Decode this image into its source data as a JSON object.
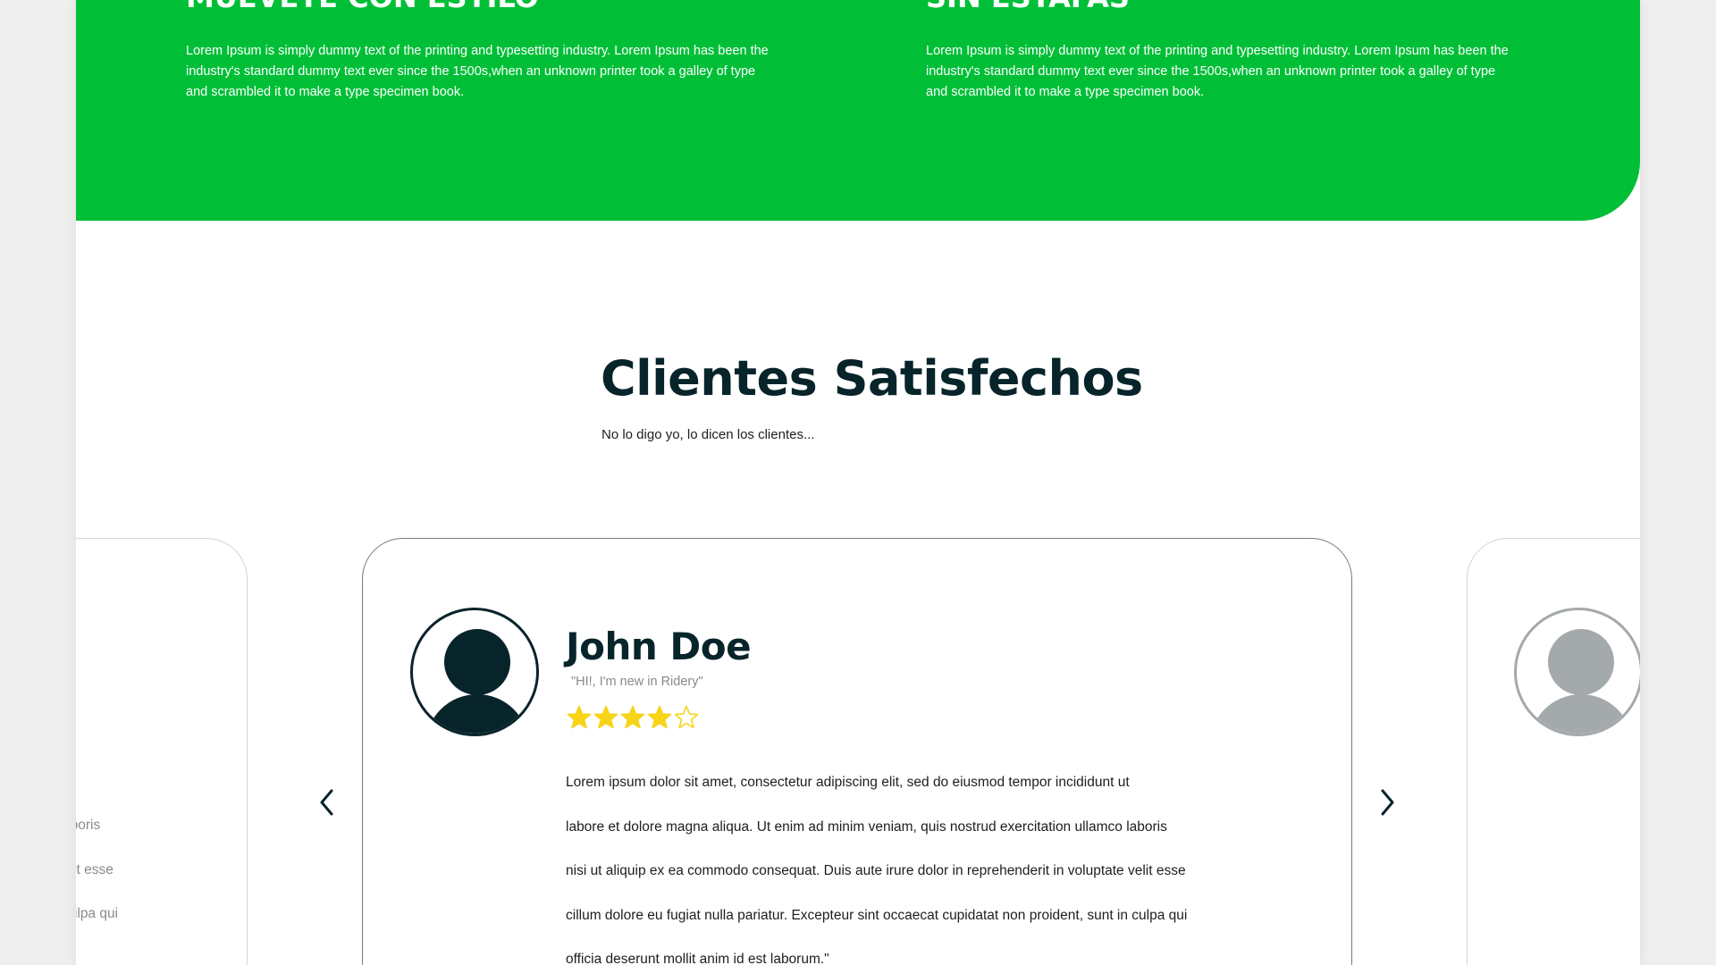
{
  "colors": {
    "brand_green": "#00bf37",
    "heading_dark": "#08242b",
    "body_text": "#1e1e1e",
    "muted_text": "#8a8a8a",
    "star_gold": "#f7d417",
    "avatar_faded": "#a4a9ac",
    "page_bg": "#efefef"
  },
  "hero": {
    "features": [
      {
        "title": "MUÉVETE CON ESTILO",
        "text": "Lorem Ipsum is simply dummy text of the printing and typesetting industry. Lorem Ipsum has been the industry's standard dummy text ever since the 1500s,when an unknown printer took a galley of type and scrambled it to make a type specimen book."
      },
      {
        "title": "SIN ESTAFAS",
        "text": "Lorem Ipsum is simply dummy text of the printing and typesetting industry. Lorem Ipsum has been the industry's standard dummy text ever since the 1500s,when an unknown printer took a galley of type and scrambled it to make a type specimen book."
      }
    ]
  },
  "testimonials": {
    "title": "Clientes Satisfechos",
    "subtitle": "No lo digo yo, lo dicen los clientes...",
    "current": {
      "name": "John Doe",
      "tagline": "\"HI!, I'm new in Ridery\"",
      "rating": 4,
      "rating_max": 5,
      "avatar_icon": "user-avatar-icon",
      "review_lines": [
        "Lorem ipsum dolor sit amet, consectetur adipiscing elit, sed do eiusmod tempor incididunt ut",
        "labore et dolore magna aliqua. Ut enim ad minim veniam, quis nostrud exercitation ullamco laboris",
        "nisi ut aliquip ex ea commodo consequat. Duis aute irure dolor in reprehenderit in voluptate velit esse",
        "cillum dolore eu fugiat nulla pariatur. Excepteur sint occaecat cupidatat non proident, sunt in culpa qui",
        "officia deserunt mollit anim id est laborum.\""
      ]
    },
    "previous_card_visible_lines": [
      "aboris",
      "elit esse",
      "culpa qui"
    ],
    "prev_icon": "chevron-left-icon",
    "next_icon": "chevron-right-icon"
  }
}
